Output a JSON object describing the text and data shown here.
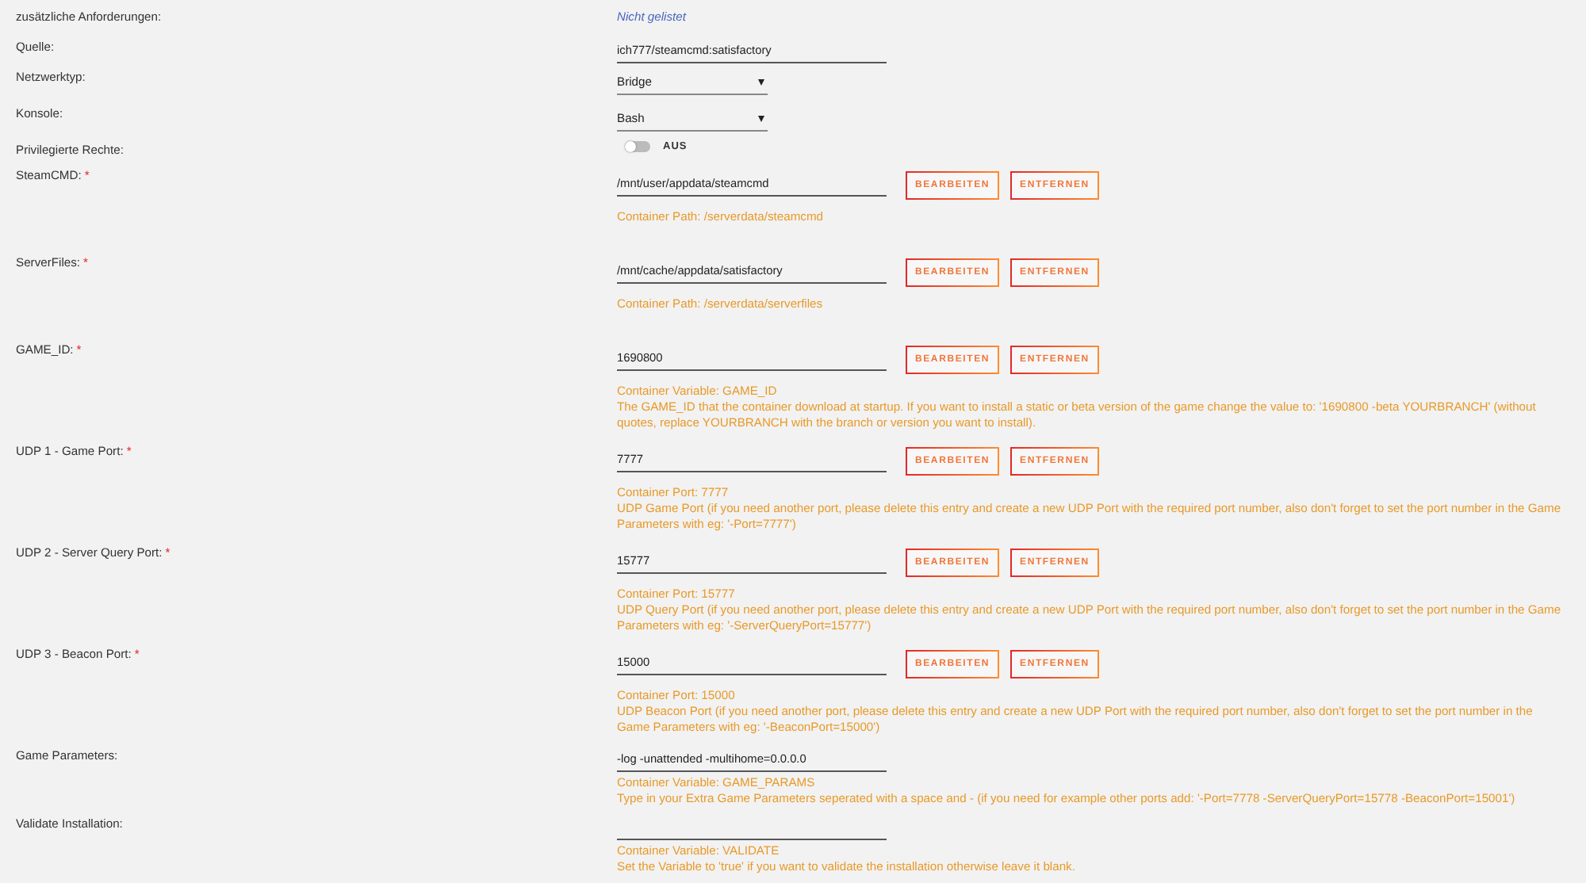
{
  "fields": [
    {
      "kind": "note",
      "label": "zusätzliche Anforderungen:",
      "value": "Nicht gelistet"
    },
    {
      "kind": "text",
      "label": "Quelle:",
      "value": "ich777/steamcmd:satisfactory"
    },
    {
      "kind": "select",
      "label": "Netzwerktyp:",
      "value": "Bridge"
    },
    {
      "kind": "select",
      "label": "Konsole:",
      "value": "Bash"
    },
    {
      "kind": "switch",
      "label": "Privilegierte Rechte:",
      "on": false,
      "state_label": "AUS"
    },
    {
      "kind": "config",
      "label": "SteamCMD:",
      "required_mark": "*",
      "value": "/mnt/user/appdata/steamcmd",
      "buttons": [
        "BEARBEITEN",
        "ENTFERNEN"
      ],
      "help": [
        "Container Path: /serverdata/steamcmd"
      ]
    },
    {
      "kind": "config",
      "label": "ServerFiles:",
      "required_mark": "*",
      "value": "/mnt/cache/appdata/satisfactory",
      "buttons": [
        "BEARBEITEN",
        "ENTFERNEN"
      ],
      "help": [
        "Container Path: /serverdata/serverfiles"
      ]
    },
    {
      "kind": "config",
      "label": "GAME_ID:",
      "required_mark": "*",
      "value": "1690800",
      "buttons": [
        "BEARBEITEN",
        "ENTFERNEN"
      ],
      "help": [
        "Container Variable: GAME_ID",
        "The GAME_ID that the container download at startup. If you want to install a static or beta version of the game change the value to: '1690800 -beta YOURBRANCH' (without quotes, replace YOURBRANCH with the branch or version you want to install)."
      ]
    },
    {
      "kind": "config",
      "label": "UDP 1 - Game Port:",
      "required_mark": "*",
      "value": "7777",
      "buttons": [
        "BEARBEITEN",
        "ENTFERNEN"
      ],
      "help": [
        "Container Port: 7777",
        "UDP Game Port (if you need another port, please delete this entry and create a new UDP Port with the required port number, also don't forget to set the port number in the Game Parameters with eg: '-Port=7777')"
      ]
    },
    {
      "kind": "config",
      "label": "UDP 2 - Server Query Port:",
      "required_mark": "*",
      "value": "15777",
      "buttons": [
        "BEARBEITEN",
        "ENTFERNEN"
      ],
      "help": [
        "Container Port: 15777",
        "UDP Query Port (if you need another port, please delete this entry and create a new UDP Port with the required port number, also don't forget to set the port number in the Game Parameters with eg: '-ServerQueryPort=15777')"
      ]
    },
    {
      "kind": "config",
      "label": "UDP 3 - Beacon Port:",
      "required_mark": "*",
      "value": "15000",
      "buttons": [
        "BEARBEITEN",
        "ENTFERNEN"
      ],
      "help": [
        "Container Port: 15000",
        "UDP Beacon Port (if you need another port, please delete this entry and create a new UDP Port with the required port number, also don't forget to set the port number in the Game Parameters with eg: '-BeaconPort=15000')"
      ]
    },
    {
      "kind": "plain",
      "label": "Game Parameters:",
      "value": "-log -unattended -multihome=0.0.0.0",
      "help": [
        "Container Variable: GAME_PARAMS",
        "Type in your Extra Game Parameters seperated with a space and - (if you need for example other ports add: '-Port=7778 -ServerQueryPort=15778 -BeaconPort=15001')"
      ]
    },
    {
      "kind": "plain",
      "label": "Validate Installation:",
      "help": [
        "Container Variable: VALIDATE",
        "Set the Variable to 'true' if you want to validate the installation otherwise leave it blank."
      ]
    }
  ]
}
